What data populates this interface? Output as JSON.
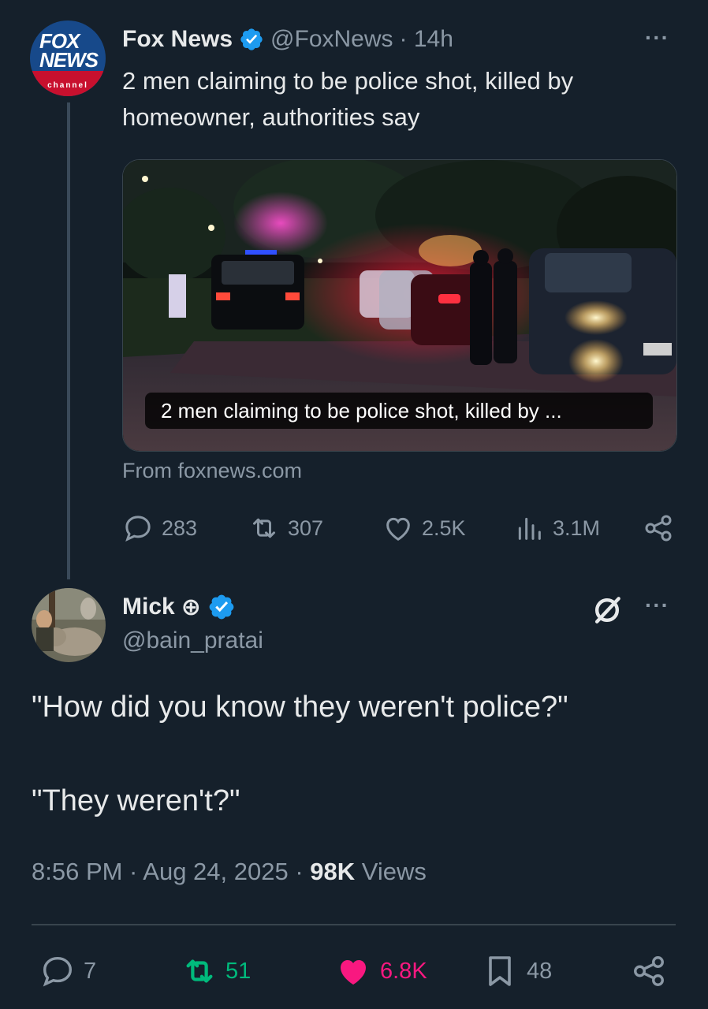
{
  "original_tweet": {
    "avatar_label": "FOX NEWS",
    "avatar_sublabel": "channel",
    "display_name": "Fox News",
    "handle": "@FoxNews",
    "time": "· 14h",
    "more": "···",
    "text": "2 men claiming to be police shot, killed by homeowner, authorities say",
    "card": {
      "caption": "2 men claiming to be police shot, killed by ...",
      "source": "From foxnews.com"
    },
    "stats": {
      "replies": "283",
      "reposts": "307",
      "likes": "2.5K",
      "views": "3.1M"
    }
  },
  "reply_tweet": {
    "display_name": "Mick",
    "name_suffix": "⊕",
    "handle": "@bain_pratai",
    "more": "···",
    "line1": "\"How did you know they weren't police?\"",
    "line2": "\"They weren't?\"",
    "time": "8:56 PM · Aug 24, 2025 · ",
    "views_count": "98K",
    "views_label": " Views",
    "stats": {
      "replies": "7",
      "reposts": "51",
      "likes": "6.8K",
      "bookmarks": "48"
    }
  },
  "colors": {
    "background": "#15202b",
    "text": "#e7e9ea",
    "muted": "#8b98a5",
    "verified": "#1d9bf0",
    "repost_active": "#00ba7c",
    "like_active": "#f91880"
  }
}
